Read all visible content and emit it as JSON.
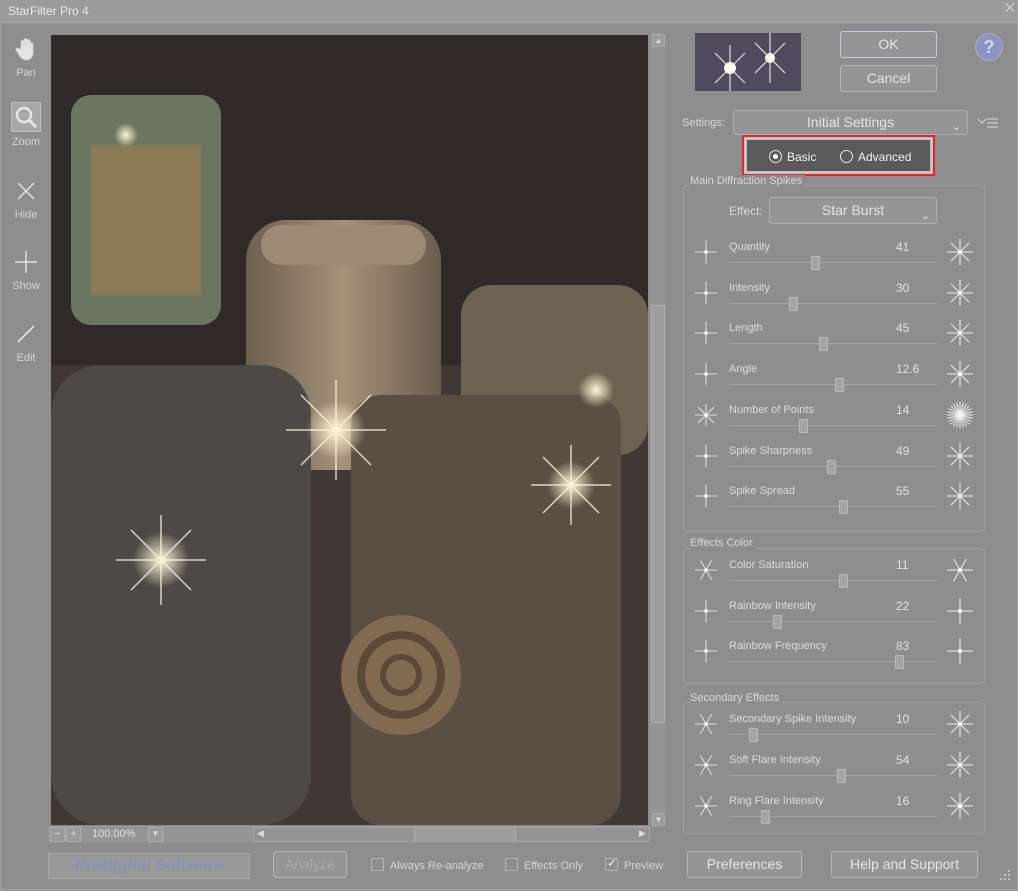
{
  "window": {
    "title": "StarFilter Pro 4"
  },
  "tools": [
    {
      "label": "Pan",
      "icon": "hand-icon"
    },
    {
      "label": "Zoom",
      "icon": "magnifier-icon"
    },
    {
      "label": "Hide",
      "icon": "cross-icon"
    },
    {
      "label": "Show",
      "icon": "plus-icon"
    },
    {
      "label": "Edit",
      "icon": "pen-icon"
    }
  ],
  "zoom": {
    "value": "100.00%"
  },
  "buttons": {
    "ok": "OK",
    "cancel": "Cancel",
    "analyze": "Analyze",
    "preferences": "Preferences",
    "help_support": "Help and Support",
    "help_icon": "?"
  },
  "logo": {
    "text_1": "ProDigital",
    "text_2": " Software"
  },
  "checkboxes": [
    {
      "label": "Always Re-analyze",
      "checked": false
    },
    {
      "label": "Effects Only",
      "checked": false
    },
    {
      "label": "Preview",
      "checked": true
    }
  ],
  "settings": {
    "label": "Settings:",
    "value": "Initial Settings"
  },
  "mode": {
    "basic": "Basic",
    "advanced": "Advanced",
    "selected": "Basic"
  },
  "main_group": {
    "title": "Main Diffraction Spikes",
    "effect_label": "Effect:",
    "effect_value": "Star Burst",
    "sliders": [
      {
        "name": "Quantity",
        "value": "41",
        "fraction": 0.41
      },
      {
        "name": "Intensity",
        "value": "30",
        "fraction": 0.3
      },
      {
        "name": "Length",
        "value": "45",
        "fraction": 0.45
      },
      {
        "name": "Angle",
        "value": "12.6",
        "fraction": 0.53
      },
      {
        "name": "Number of Points",
        "value": "14",
        "fraction": 0.35
      },
      {
        "name": "Spike Sharpness",
        "value": "49",
        "fraction": 0.49
      },
      {
        "name": "Spike Spread",
        "value": "55",
        "fraction": 0.55
      }
    ]
  },
  "color_group": {
    "title": "Effects Color",
    "sliders": [
      {
        "name": "Color Saturation",
        "value": "11",
        "fraction": 0.55
      },
      {
        "name": "Rainbow Intensity",
        "value": "22",
        "fraction": 0.22
      },
      {
        "name": "Rainbow Frequency",
        "value": "83",
        "fraction": 0.83
      }
    ]
  },
  "secondary_group": {
    "title": "Secondary Effects",
    "sliders": [
      {
        "name": "Secondary Spike Intensity",
        "value": "10",
        "fraction": 0.1
      },
      {
        "name": "Soft Flare Intensity",
        "value": "54",
        "fraction": 0.54
      },
      {
        "name": "Ring Flare Intensity",
        "value": "16",
        "fraction": 0.16
      }
    ]
  }
}
